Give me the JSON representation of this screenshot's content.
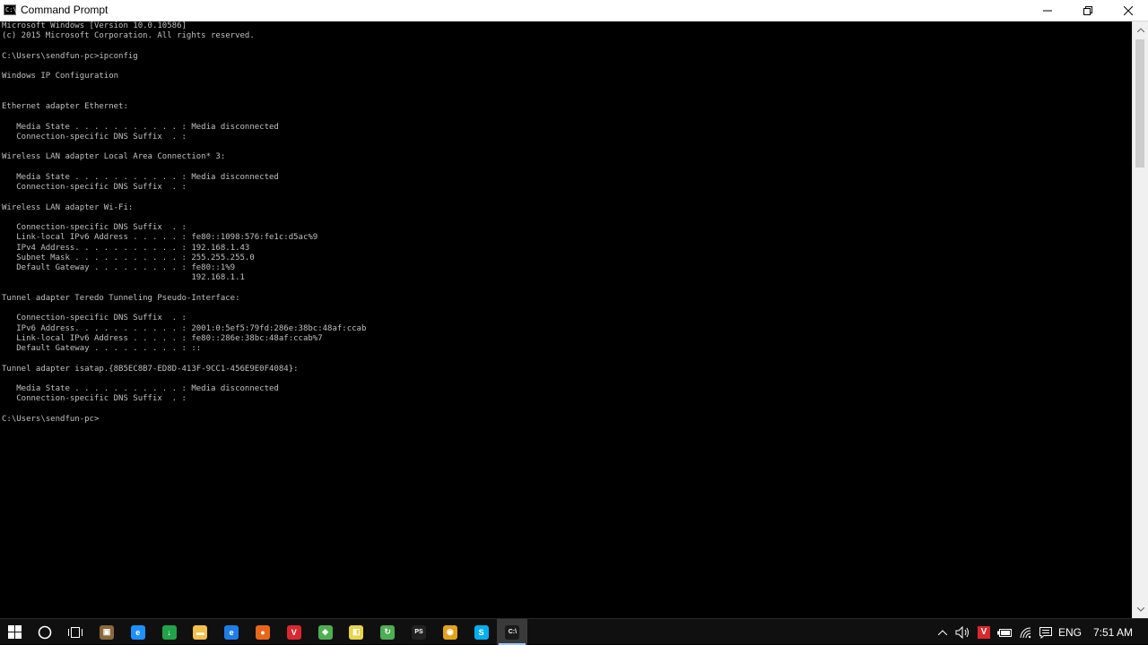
{
  "window": {
    "title": "Command Prompt",
    "minimize_label": "Minimize",
    "maximize_label": "Restore",
    "close_label": "Close"
  },
  "console": {
    "lines": [
      "Microsoft Windows [Version 10.0.10586]",
      "(c) 2015 Microsoft Corporation. All rights reserved.",
      "",
      "C:\\Users\\sendfun-pc>ipconfig",
      "",
      "Windows IP Configuration",
      "",
      "",
      "Ethernet adapter Ethernet:",
      "",
      "   Media State . . . . . . . . . . . : Media disconnected",
      "   Connection-specific DNS Suffix  . :",
      "",
      "Wireless LAN adapter Local Area Connection* 3:",
      "",
      "   Media State . . . . . . . . . . . : Media disconnected",
      "   Connection-specific DNS Suffix  . :",
      "",
      "Wireless LAN adapter Wi-Fi:",
      "",
      "   Connection-specific DNS Suffix  . :",
      "   Link-local IPv6 Address . . . . . : fe80::1098:576:fe1c:d5ac%9",
      "   IPv4 Address. . . . . . . . . . . : 192.168.1.43",
      "   Subnet Mask . . . . . . . . . . . : 255.255.255.0",
      "   Default Gateway . . . . . . . . . : fe80::1%9",
      "                                       192.168.1.1",
      "",
      "Tunnel adapter Teredo Tunneling Pseudo-Interface:",
      "",
      "   Connection-specific DNS Suffix  . :",
      "   IPv6 Address. . . . . . . . . . . : 2001:0:5ef5:79fd:286e:38bc:48af:ccab",
      "   Link-local IPv6 Address . . . . . : fe80::286e:38bc:48af:ccab%7",
      "   Default Gateway . . . . . . . . . : ::",
      "",
      "Tunnel adapter isatap.{8B5EC8B7-ED8D-413F-9CC1-456E9E0F4084}:",
      "",
      "   Media State . . . . . . . . . . . : Media disconnected",
      "   Connection-specific DNS Suffix  . :",
      "",
      "C:\\Users\\sendfun-pc>"
    ]
  },
  "taskbar": {
    "apps": [
      {
        "name": "file-viewer",
        "icon": "image-viewer-icon",
        "color": "#8a6a3a",
        "glyph": "▣"
      },
      {
        "name": "internet-explorer",
        "icon": "internet-explorer-icon",
        "color": "#1e90ff",
        "glyph": "e"
      },
      {
        "name": "download-manager",
        "icon": "download-arrow-icon",
        "color": "#22a34a",
        "glyph": "↓"
      },
      {
        "name": "file-explorer",
        "icon": "folder-icon",
        "color": "#f2c14e",
        "glyph": "▬"
      },
      {
        "name": "edge",
        "icon": "edge-browser-icon",
        "color": "#1f7de6",
        "glyph": "e"
      },
      {
        "name": "firefox",
        "icon": "firefox-icon",
        "color": "#e8671c",
        "glyph": "●"
      },
      {
        "name": "vivaldi",
        "icon": "vivaldi-icon",
        "color": "#d9282f",
        "glyph": "V"
      },
      {
        "name": "network-tool",
        "icon": "network-icon",
        "color": "#4caf50",
        "glyph": "◆"
      },
      {
        "name": "notes",
        "icon": "sticky-notes-icon",
        "color": "#e9d44a",
        "glyph": "◧"
      },
      {
        "name": "refresh-app",
        "icon": "green-circle-icon",
        "color": "#4caf50",
        "glyph": "↻"
      },
      {
        "name": "photoshop",
        "icon": "photoshop-icon",
        "color": "#222222",
        "glyph": "PS"
      },
      {
        "name": "chrome",
        "icon": "chrome-icon",
        "color": "#e3a21a",
        "glyph": "◉"
      },
      {
        "name": "skype",
        "icon": "skype-icon",
        "color": "#00aff0",
        "glyph": "S"
      },
      {
        "name": "command-prompt",
        "icon": "command-prompt-icon",
        "color": "#1a1a1a",
        "glyph": "C:\\"
      }
    ],
    "tray": {
      "language": "ENG",
      "time": "7:51 AM"
    }
  }
}
